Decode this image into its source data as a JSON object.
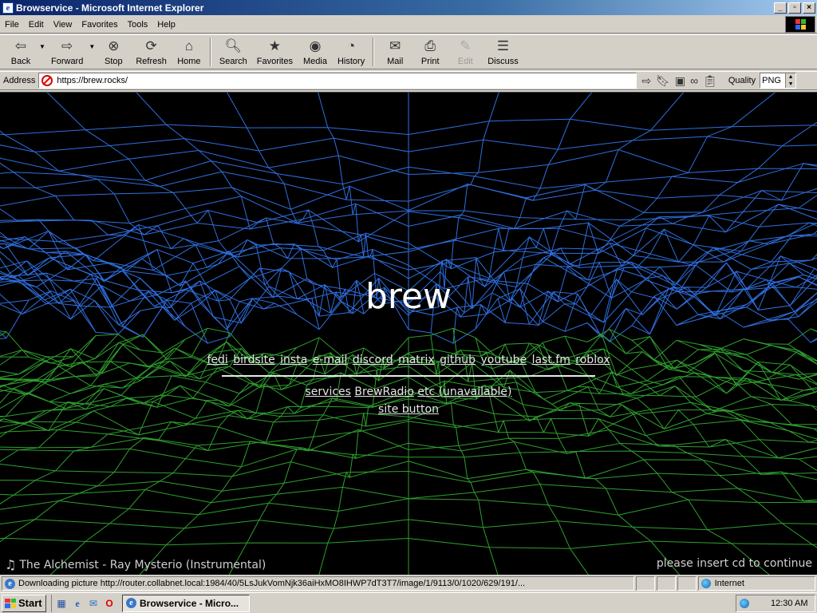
{
  "window": {
    "title": "Browservice - Microsoft Internet Explorer",
    "buttons": [
      "_",
      "▫",
      "×"
    ]
  },
  "menu": [
    "File",
    "Edit",
    "View",
    "Favorites",
    "Tools",
    "Help"
  ],
  "toolbar": {
    "back": "Back",
    "forward": "Forward",
    "stop": "Stop",
    "refresh": "Refresh",
    "home": "Home",
    "search": "Search",
    "favorites": "Favorites",
    "media": "Media",
    "history": "History",
    "mail": "Mail",
    "print": "Print",
    "edit": "Edit",
    "discuss": "Discuss"
  },
  "address": {
    "label": "Address",
    "url": "https://brew.rocks/",
    "quality_label": "Quality",
    "quality_value": "PNG"
  },
  "page": {
    "brand": "brew",
    "links": [
      "fedi",
      "birdsite",
      "insta",
      "e-mail",
      "discord",
      "matrix",
      "github",
      "youtube",
      "last.fm",
      "roblox"
    ],
    "links2": [
      "services",
      "BrewRadio",
      "etc (unavailable)"
    ],
    "site_button": "site button",
    "now_playing": "The Alchemist - Ray Mysterio (Instrumental)",
    "insert_cd": "please insert cd to continue",
    "colors": {
      "upper_mesh": "#2f6fe0",
      "lower_mesh": "#2fa02f",
      "background": "#000000"
    }
  },
  "status": {
    "text": "Downloading picture http://router.collabnet.local:1984/40/5LsJukVomNjk36aiHxMO8IHWP7dT3T7/image/1/9113/0/1020/629/191/...",
    "zone": "Internet"
  },
  "taskbar": {
    "start": "Start",
    "task": "Browservice - Micro...",
    "clock": "12:30 AM"
  }
}
